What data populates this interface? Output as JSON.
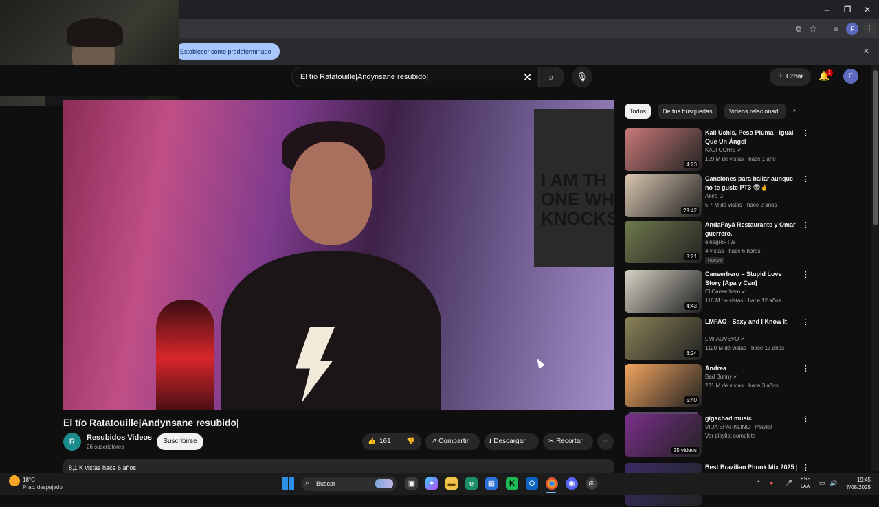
{
  "browser": {
    "infobar_chip": "Establecer como predeterminado",
    "profile_initial": "F",
    "window_controls": [
      "–",
      "❐",
      "✕"
    ]
  },
  "youtube": {
    "search_value": "El tío Ratatouille|Andynsane resubido|",
    "create_label": "Crear",
    "notification_count": "1",
    "user_initial": "F"
  },
  "video": {
    "title": "El tío Ratatouille|Andynsane resubido|",
    "channel_initial": "R",
    "channel_name": "Resubidos Videos",
    "subscribers": "26 suscriptores",
    "subscribe_label": "Suscribirse",
    "likes": "161",
    "share_label": "Compartir",
    "download_label": "Descargar",
    "clip_label": "Recortar",
    "views_line": "8,1 K vistas  hace 6 años",
    "poster_text": "I AM TH\nONE WH\nKNOCKS"
  },
  "chips": [
    "Todos",
    "De tus búsquedas",
    "Videos relacionad"
  ],
  "recommendations": [
    {
      "title": "Kali Uchis, Peso Pluma - Igual Que Un Ángel",
      "channel": "KALI UCHIS",
      "verified": true,
      "meta": "159 M de vistas · hace 1 año",
      "duration": "4:23",
      "color": "#c97a79"
    },
    {
      "title": "Canciones para bailar aunque no te guste PT3 👽✌️",
      "channel": "Akiro C:",
      "verified": false,
      "meta": "5,7 M de vistas · hace 2 años",
      "duration": "29:42",
      "color": "#d9c7b0"
    },
    {
      "title": "AndaPayá Restaurante y Omar guerrero.",
      "channel": "elnegroFTW",
      "verified": false,
      "meta": "4 vistas · hace 6 horas",
      "badge": "Nuevo",
      "duration": "3:21",
      "color": "#6f7a4c"
    },
    {
      "title": "Canserbero – Stupid Love Story [Apa y Can]",
      "channel": "El Canserbero",
      "verified": true,
      "meta": "116 M de vistas · hace 12 años",
      "duration": "4:43",
      "color": "#d7d2c4"
    },
    {
      "title": "LMFAO - Saxy and I Know It",
      "channel": "LMFAOVEVO",
      "verified": true,
      "meta": "1120 M de vistas · hace 13 años",
      "duration": "3:24",
      "color": "#8a8256"
    },
    {
      "title": "Andrea",
      "channel": "Bad Bunny",
      "verified": true,
      "meta": "231 M de vistas · hace 3 años",
      "duration": "5:40",
      "color": "#f2a55f"
    },
    {
      "title": "gigachad music",
      "channel": "VIDA SPARKLING · Playlist",
      "verified": false,
      "meta": "Ver playlist completa",
      "duration": "25 videos",
      "color": "#7a2f8a"
    },
    {
      "title": "Best Brazilian Phonk Mix 2025 |",
      "channel": "",
      "verified": false,
      "meta": "",
      "duration": "",
      "color": "#3a2c66"
    }
  ],
  "taskbar": {
    "temperature": "18°C",
    "weather": "Prac. despejado",
    "search_label": "Buscar",
    "lang_top": "ESP",
    "lang_bottom": "LAA",
    "time": "19:45",
    "date": "7/08/2025"
  }
}
